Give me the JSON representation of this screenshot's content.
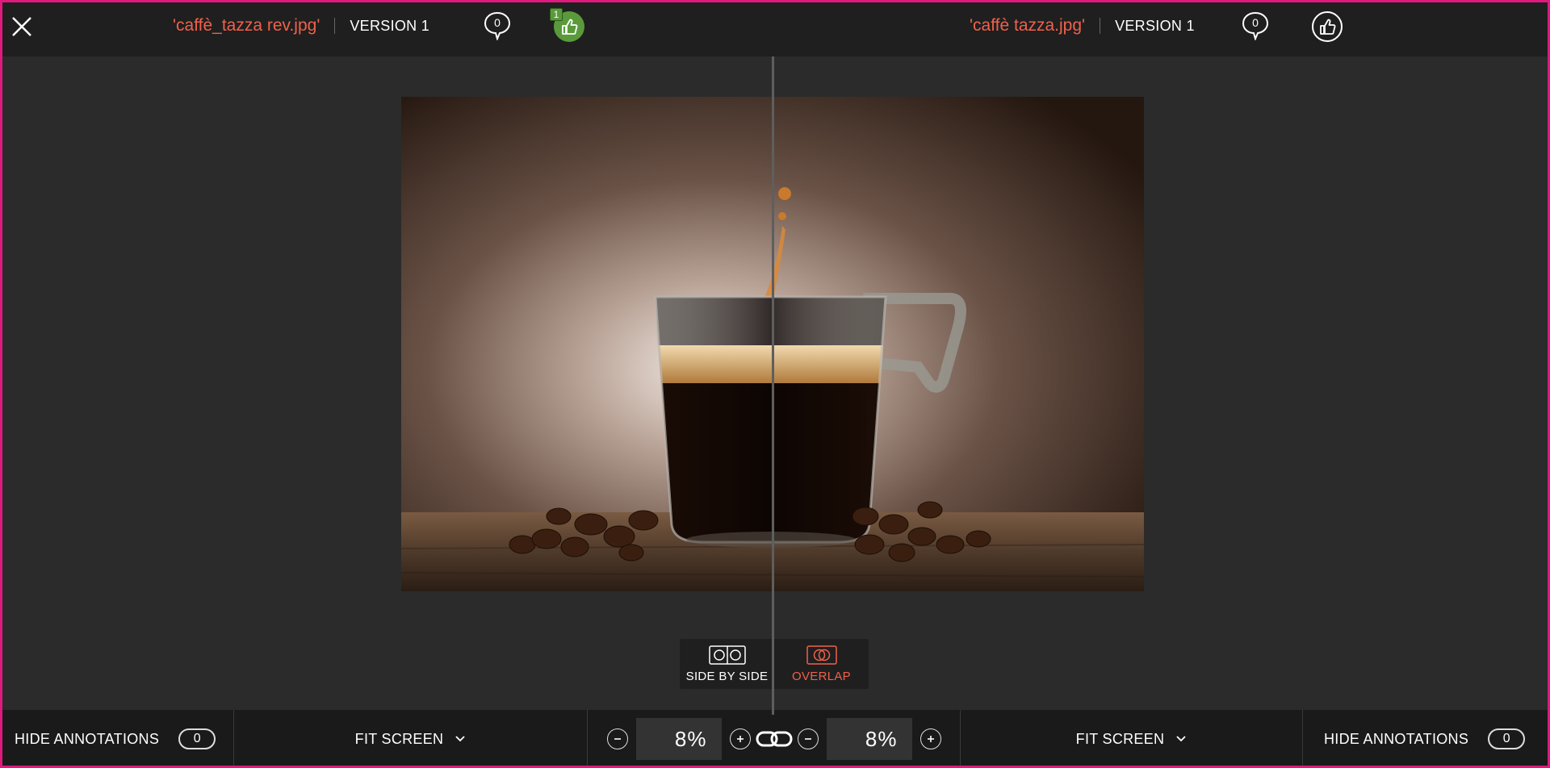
{
  "header": {
    "left": {
      "file_name": "'caffè_tazza rev.jpg'",
      "version": "VERSION 1",
      "comments": "0",
      "likes": "1"
    },
    "right": {
      "file_name": "'caffè tazza.jpg'",
      "version": "VERSION 1",
      "comments": "0"
    }
  },
  "mode_toggle": {
    "side_by_side": "SIDE BY SIDE",
    "overlap": "OVERLAP",
    "active": "overlap"
  },
  "bottom_bar": {
    "left": {
      "hide_annotations": "HIDE ANNOTATIONS",
      "annotation_count": "0",
      "fit_screen": "FIT SCREEN",
      "zoom": "8%"
    },
    "right": {
      "zoom": "8%",
      "fit_screen": "FIT SCREEN",
      "hide_annotations": "HIDE ANNOTATIONS",
      "annotation_count": "0"
    }
  },
  "icons": [
    "close-icon",
    "comment-icon",
    "thumbs-up-icon",
    "side-by-side-icon",
    "overlap-icon",
    "zoom-out-icon",
    "zoom-in-icon",
    "link-icon",
    "chevron-down-icon"
  ],
  "colors": {
    "accent": "#f0614b",
    "like_green": "#5b9a3b",
    "background": "#2b2b2b",
    "header": "#1f1f1f",
    "frame": "#e0197d"
  }
}
